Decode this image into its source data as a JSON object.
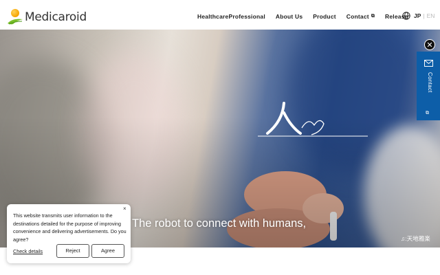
{
  "brand": {
    "name": "Medicaroid"
  },
  "nav": {
    "items": [
      {
        "label": "HealthcareProfessional",
        "external": false
      },
      {
        "label": "About Us",
        "external": false
      },
      {
        "label": "Product",
        "external": false
      },
      {
        "label": "Contact",
        "external": true
      },
      {
        "label": "Release",
        "external": false
      }
    ],
    "external_icon": "⧉"
  },
  "language": {
    "current": "JP",
    "separator": "|",
    "other": "EN"
  },
  "hero": {
    "caption": "The robot to connect with humans,",
    "mark_kanji": "人",
    "music_credit": "♫:天地雅楽"
  },
  "contact_tab": {
    "label": "Contact",
    "close_glyph": "✕",
    "external_icon": "⧉"
  },
  "cookie_banner": {
    "text": "This website transmits user information to the destinations detailed for the purpose of improving convenience and delivering advertisements. Do you agree?",
    "details_link": "Check details",
    "reject_label": "Reject",
    "agree_label": "Agree",
    "close_glyph": "×"
  },
  "colors": {
    "accent": "#0d5ea8",
    "logo_orange": "#f5a300",
    "logo_green": "#7bbf2a"
  }
}
